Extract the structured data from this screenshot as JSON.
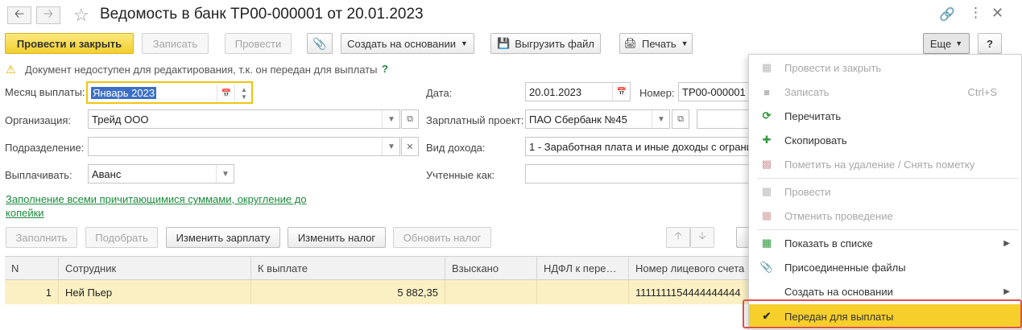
{
  "window": {
    "title": "Ведомость в банк ТР00-000001 от 20.01.2023"
  },
  "toolbar": {
    "post_close": "Провести и закрыть",
    "save": "Записать",
    "post": "Провести",
    "create_based": "Создать на основании",
    "export_file": "Выгрузить файл",
    "print": "Печать",
    "more": "Еще",
    "help": "?"
  },
  "notice": {
    "text": "Документ недоступен для редактирования, т.к. он передан для выплаты",
    "help": "?"
  },
  "form": {
    "month_label": "Месяц выплаты:",
    "month_value": "Январь 2023",
    "org_label": "Организация:",
    "org_value": "Трейд ООО",
    "dept_label": "Подразделение:",
    "dept_value": "",
    "pay_label": "Выплачивать:",
    "pay_value": "Аванс",
    "date_label": "Дата:",
    "date_value": "20.01.2023",
    "number_label": "Номер:",
    "number_value": "ТР00-000001",
    "project_label": "Зарплатный проект:",
    "project_value": "ПАО Сбербанк №45",
    "income_label": "Вид дохода:",
    "income_value": "1 - Заработная плата и иные доходы с ограни",
    "accounted_label": "Учтенные как:",
    "accounted_value": ""
  },
  "fill_link": {
    "line1": "Заполнение всеми причитающимися суммами, округление до",
    "line2": "копейки"
  },
  "table_toolbar": {
    "fill": "Заполнить",
    "select": "Подобрать",
    "change_salary": "Изменить зарплату",
    "change_tax": "Изменить налог",
    "update_tax": "Обновить налог"
  },
  "table": {
    "columns": [
      "N",
      "Сотрудник",
      "К выплате",
      "Взыскано",
      "НДФЛ к пере…",
      "Номер лицевого счета"
    ],
    "rows": [
      {
        "n": "1",
        "employee": "Ней Пьер",
        "to_pay": "5 882,35",
        "collected": "",
        "ndfl": "",
        "account": "1111111154444444444"
      }
    ]
  },
  "more_menu": {
    "items": [
      {
        "label": "Провести и закрыть",
        "shortcut": "",
        "icon": "post-close-icon"
      },
      {
        "label": "Записать",
        "shortcut": "Ctrl+S",
        "icon": "save-icon"
      },
      {
        "label": "Перечитать",
        "shortcut": "",
        "icon": "refresh-icon"
      },
      {
        "label": "Скопировать",
        "shortcut": "",
        "icon": "copy-icon"
      },
      {
        "label": "Пометить на удаление / Снять пометку",
        "shortcut": "",
        "icon": "mark-delete-icon"
      },
      {
        "label": "Провести",
        "shortcut": "",
        "icon": "post-icon"
      },
      {
        "label": "Отменить проведение",
        "shortcut": "",
        "icon": "unpost-icon"
      },
      {
        "label": "Показать в списке",
        "shortcut": "",
        "icon": "show-in-list-icon"
      },
      {
        "label": "Присоединенные файлы",
        "shortcut": "",
        "icon": "attachment-icon"
      },
      {
        "label": "Создать на основании",
        "shortcut": "",
        "icon": ""
      },
      {
        "label": "Передан для выплаты",
        "shortcut": "",
        "icon": "checkmark-icon"
      }
    ]
  },
  "colors": {
    "primary_button": "#f3cf2f",
    "link": "#1c8a3c",
    "highlight_row": "#fbf0c4",
    "menu_selected": "#f7cf2a",
    "callout_border": "#d9534f"
  }
}
